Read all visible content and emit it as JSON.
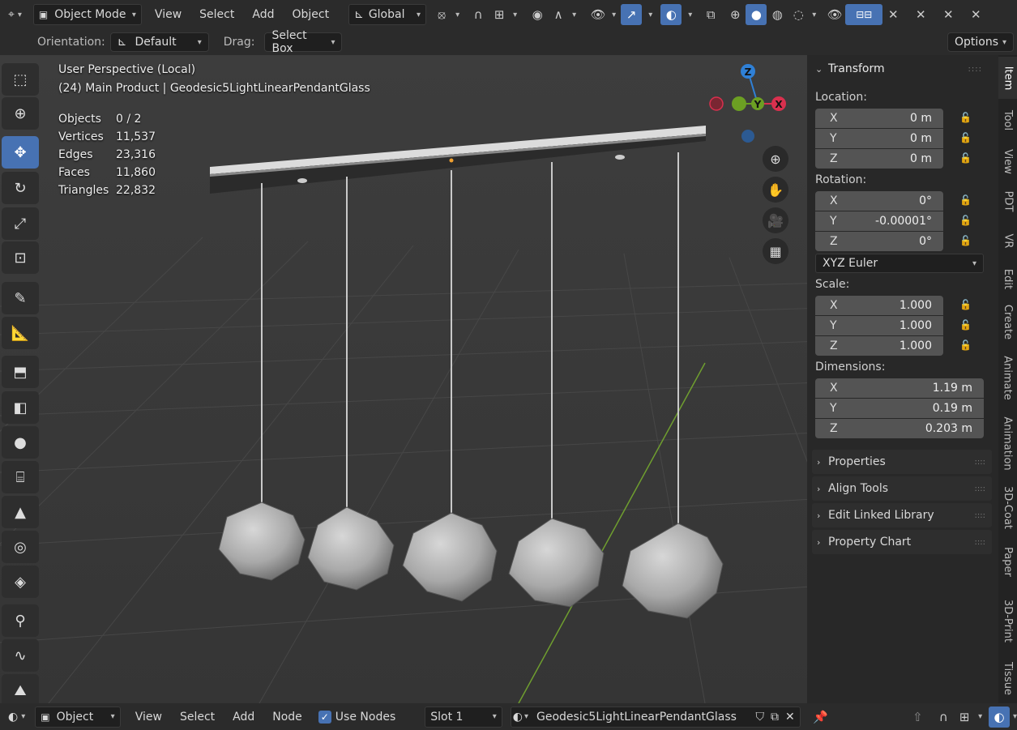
{
  "header": {
    "mode": "Object Mode",
    "menus": [
      "View",
      "Select",
      "Add",
      "Object"
    ],
    "transform_orientation": "Global"
  },
  "tool_header": {
    "orientation_label": "Orientation:",
    "orientation_value": "Default",
    "drag_label": "Drag:",
    "drag_value": "Select Box",
    "options": "Options"
  },
  "viewport": {
    "view_name": "User Perspective (Local)",
    "collection": "(24) Main Product | Geodesic5LightLinearPendantGlass",
    "stats": [
      {
        "label": "Objects",
        "value": "0 / 2"
      },
      {
        "label": "Vertices",
        "value": "11,537"
      },
      {
        "label": "Edges",
        "value": "23,316"
      },
      {
        "label": "Faces",
        "value": "11,860"
      },
      {
        "label": "Triangles",
        "value": "22,832"
      }
    ],
    "gizmo": {
      "z": "Z",
      "y": "Y",
      "x": "X"
    }
  },
  "sidebar": {
    "transform_title": "Transform",
    "location_label": "Location:",
    "location": [
      {
        "axis": "X",
        "value": "0 m"
      },
      {
        "axis": "Y",
        "value": "0 m"
      },
      {
        "axis": "Z",
        "value": "0 m"
      }
    ],
    "rotation_label": "Rotation:",
    "rotation": [
      {
        "axis": "X",
        "value": "0°"
      },
      {
        "axis": "Y",
        "value": "-0.00001°"
      },
      {
        "axis": "Z",
        "value": "0°"
      }
    ],
    "rotation_mode": "XYZ Euler",
    "scale_label": "Scale:",
    "scale": [
      {
        "axis": "X",
        "value": "1.000"
      },
      {
        "axis": "Y",
        "value": "1.000"
      },
      {
        "axis": "Z",
        "value": "1.000"
      }
    ],
    "dimensions_label": "Dimensions:",
    "dimensions": [
      {
        "axis": "X",
        "value": "1.19 m"
      },
      {
        "axis": "Y",
        "value": "0.19 m"
      },
      {
        "axis": "Z",
        "value": "0.203 m"
      }
    ],
    "panels": [
      "Properties",
      "Align Tools",
      "Edit Linked Library",
      "Property Chart"
    ]
  },
  "right_tabs": [
    "Item",
    "Tool",
    "View",
    "PDT",
    "VR",
    "Edit",
    "Create",
    "Animate",
    "Animation",
    "3D-Coat",
    "Paper",
    "3D-Print",
    "Tissue"
  ],
  "footer": {
    "mode": "Object",
    "menus": [
      "View",
      "Select",
      "Add",
      "Node"
    ],
    "use_nodes": "Use Nodes",
    "slot": "Slot 1",
    "material": "Geodesic5LightLinearPendantGlass"
  },
  "colors": {
    "accent": "#4772b3",
    "axis_x": "#d9304e",
    "axis_y": "#6c9f23",
    "axis_z": "#2f80d6"
  }
}
